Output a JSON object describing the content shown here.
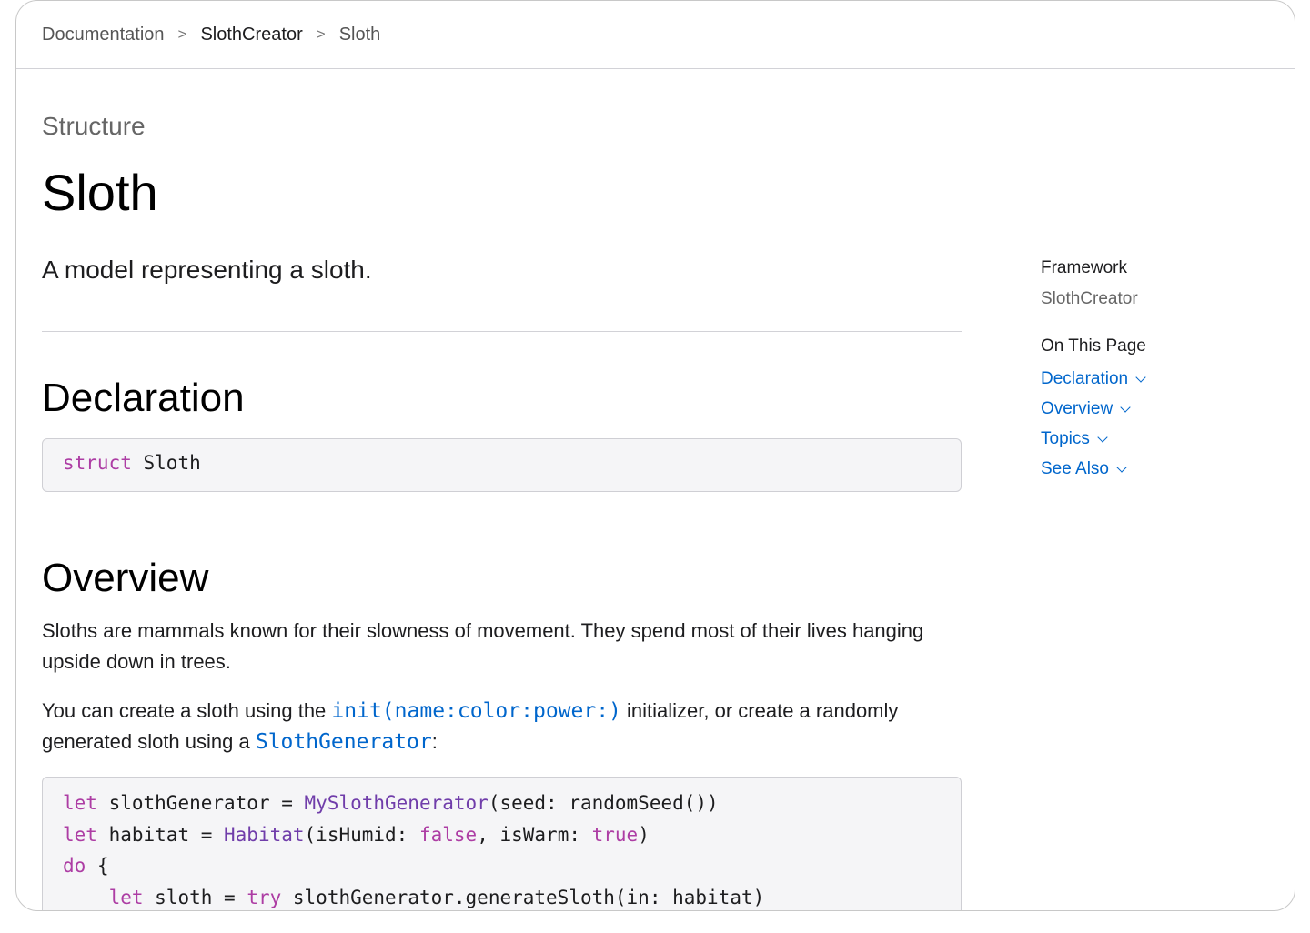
{
  "breadcrumb": {
    "items": [
      "Documentation",
      "SlothCreator",
      "Sloth"
    ],
    "separator": ">"
  },
  "header": {
    "eyebrow": "Structure",
    "title": "Sloth",
    "abstract": "A model representing a sloth."
  },
  "declaration": {
    "heading": "Declaration",
    "keyword": "struct",
    "name": "Sloth"
  },
  "overview": {
    "heading": "Overview",
    "paragraph1": "Sloths are mammals known for their slowness of movement. They spend most of their lives hanging upside down in trees.",
    "paragraph2_before": "You can create a sloth using the ",
    "paragraph2_link1": "init(name:color:power:)",
    "paragraph2_middle": " initializer, or create a randomly generated sloth using a ",
    "paragraph2_link2": "SlothGenerator",
    "paragraph2_after": ":"
  },
  "code_sample": {
    "line1": {
      "kw": "let",
      "a": " slothGenerator = ",
      "type": "MySlothGenerator",
      "b": "(seed: randomSeed())"
    },
    "line2": {
      "kw": "let",
      "a": " habitat = ",
      "type": "Habitat",
      "b": "(isHumid: ",
      "kw2": "false",
      "c": ", isWarm: ",
      "kw3": "true",
      "d": ")"
    },
    "line3": {
      "kw": "do",
      "a": " {"
    },
    "line4": {
      "indent": "    ",
      "kw": "let",
      "a": " sloth = ",
      "kw2": "try",
      "b": " slothGenerator.generateSloth(in: habitat)"
    }
  },
  "sidebar": {
    "framework_label": "Framework",
    "framework_value": "SlothCreator",
    "on_this_page_label": "On This Page",
    "toc": [
      "Declaration",
      "Overview",
      "Topics",
      "See Also"
    ]
  },
  "colors": {
    "link": "#0066cc",
    "keyword": "#ad3da4",
    "type": "#703daa",
    "code_background": "#f5f5f7"
  }
}
